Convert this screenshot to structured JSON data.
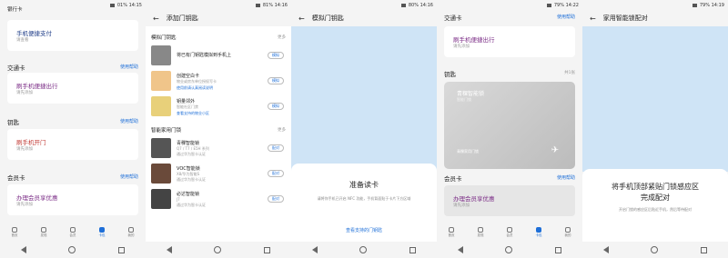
{
  "s1": {
    "status": "01% 14:15",
    "top": "银行卡",
    "cards": [
      {
        "title": "手机便捷支付",
        "sub": "请查看"
      },
      {
        "title": "刷手机便捷出行",
        "sub": "请先添加"
      },
      {
        "title": "刷手机开门",
        "sub": "请先添加"
      },
      {
        "title": "办理会员享优惠",
        "sub": "请先添加"
      }
    ],
    "sections": [
      "交通卡",
      "钥匙",
      "会员卡"
    ],
    "help": "使用帮助",
    "tabs": [
      "首页",
      "发现",
      "会员",
      "卡包",
      "我的"
    ]
  },
  "s2": {
    "status": "81% 14:16",
    "title": "添加门钥匙",
    "sec1": "模拟门钥匙",
    "more": "更多",
    "sec2": "智能家用门锁",
    "items": [
      {
        "name": "将已有门钥匙模拟到手机上",
        "desc": "",
        "link": "",
        "btn": "模拟"
      },
      {
        "name": "创建空白卡",
        "desc": "物业或房东单位授权写卡",
        "link": "使用前请认真阅读说明",
        "btn": "模拟"
      },
      {
        "name": "钥量邻外",
        "desc": "智能社区门禁",
        "link": "查看支持的物业小区",
        "btn": "模拟"
      },
      {
        "name": "青稞智能锁",
        "desc": "Q7 / T7 / E5H 系列",
        "link": "通过华为智卡认证",
        "btn": "配对"
      },
      {
        "name": "VOC智能锁",
        "desc": "X8/华为智能S",
        "link": "通过华为智卡认证",
        "btn": "配对"
      },
      {
        "name": "必达智能锁",
        "desc": "J7",
        "link": "通过华为智卡认证",
        "btn": "配对"
      }
    ]
  },
  "s3": {
    "status": "80% 14:16",
    "title": "模拟门钥匙",
    "ready": "准备读卡",
    "desc": "请将你手机已开启 NFC 功能，手机背面贴于卡片下方区域",
    "link": "查看支持的门钥匙"
  },
  "s4": {
    "status": "79% 14:22",
    "sec1": "交通卡",
    "help": "使用帮助",
    "card1": "刷手机便捷出行",
    "card1sub": "请先添加",
    "sec2": "钥匙",
    "count": "共1张",
    "keyBrand": "青稞智能锁",
    "keySub": "智能门锁",
    "keyName": "青稞家用门锁",
    "sec3": "会员卡",
    "help2": "使用帮助",
    "card3": "办理会员享优惠",
    "card3sub": "请先添加"
  },
  "s5": {
    "status": "79% 14:19",
    "title": "家用智能锁配对",
    "line1": "将手机顶部紧贴门锁感应区",
    "line2": "完成配对",
    "desc": "开启门锁的感应区后贴近手机，然后等待配对"
  }
}
